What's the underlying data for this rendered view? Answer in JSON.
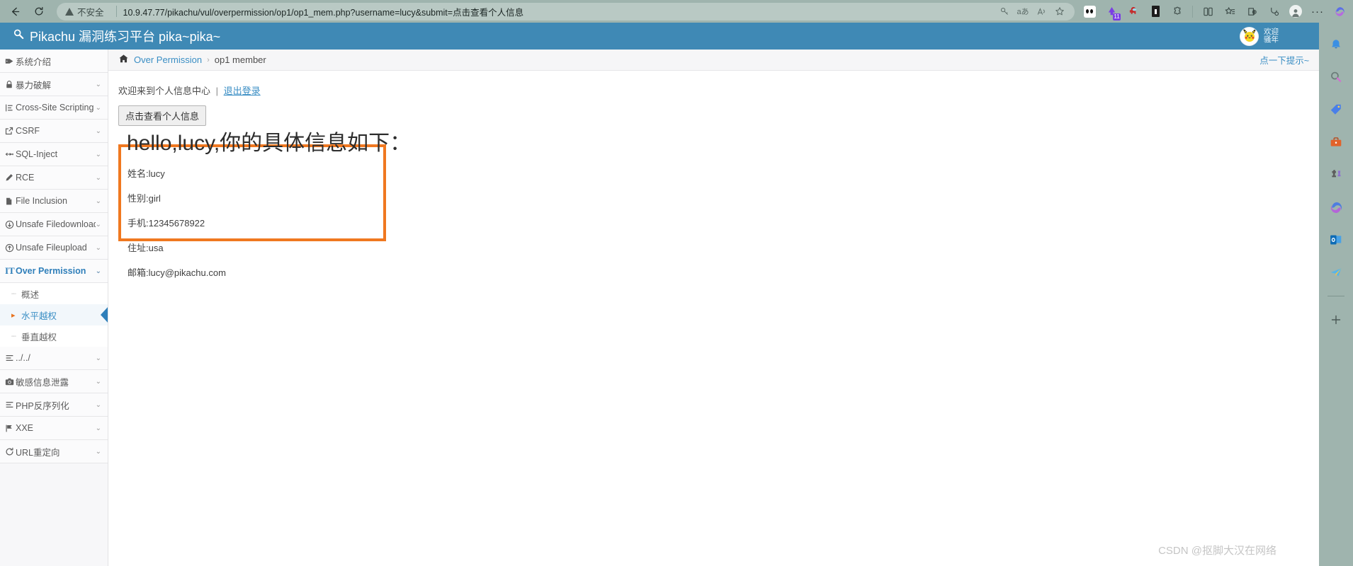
{
  "browser": {
    "back_icon": "back-arrow",
    "reload_icon": "reload",
    "security_label": "不安全",
    "url": "10.9.47.77/pikachu/vul/overpermission/op1/op1_mem.php?username=lucy&submit=点击查看个人信息",
    "omnibox_icons": [
      {
        "name": "key-icon",
        "glyph": "⚷"
      },
      {
        "name": "translate-icon",
        "glyph": "aあ"
      },
      {
        "name": "read-aloud-icon",
        "glyph": "A"
      }
    ],
    "favorite_icon": "☆",
    "toolbar_icons": [
      {
        "name": "extension-panda-icon",
        "glyph": "🐼"
      },
      {
        "name": "extension-purple-icon",
        "glyph": "🔮",
        "badge": "11"
      },
      {
        "name": "extension-amongus-icon",
        "glyph": "👾"
      },
      {
        "name": "extension-black-icon",
        "glyph": "▮"
      },
      {
        "name": "extension-puzzle-icon",
        "glyph": "🧩"
      },
      {
        "name": "split-screen-icon",
        "glyph": "◫"
      },
      {
        "name": "collections-icon",
        "glyph": "✩"
      },
      {
        "name": "browser-essentials-icon",
        "glyph": "⎙"
      },
      {
        "name": "performance-icon",
        "glyph": "🩺"
      },
      {
        "name": "profile-icon",
        "glyph": "👤"
      },
      {
        "name": "settings-more-icon",
        "glyph": "···"
      },
      {
        "name": "copilot-icon",
        "glyph": "◉"
      }
    ]
  },
  "edge_sidebar": {
    "icons": [
      {
        "name": "notifications-bell-icon",
        "glyph": "🔔"
      },
      {
        "name": "search-icon",
        "glyph": "🔍"
      },
      {
        "name": "shopping-tag-icon",
        "glyph": "🏷"
      },
      {
        "name": "tools-icon",
        "glyph": "🧰"
      },
      {
        "name": "games-icon",
        "glyph": "♟"
      },
      {
        "name": "copilot-icon",
        "glyph": "🌀"
      },
      {
        "name": "outlook-icon",
        "glyph": "📧"
      },
      {
        "name": "telegram-icon",
        "glyph": "📨"
      }
    ],
    "add_button": "+"
  },
  "site": {
    "title": "Pikachu 漏洞练习平台 pika~pika~",
    "title_icon": "magnifier-icon",
    "avatar_icon": "pikachu-avatar",
    "welcome_text": "欢迎骚年"
  },
  "nav": {
    "items": [
      {
        "label": "系统介绍",
        "icon": "tag-icon",
        "glyph": "🏷",
        "caret": false
      },
      {
        "label": "暴力破解",
        "icon": "lock-icon",
        "glyph": "🔒",
        "caret": true
      },
      {
        "label": "Cross-Site Scripting",
        "icon": "xss-icon",
        "glyph": "⊢",
        "caret": true
      },
      {
        "label": "CSRF",
        "icon": "external-link-icon",
        "glyph": "↗",
        "caret": true
      },
      {
        "label": "SQL-Inject",
        "icon": "syringe-icon",
        "glyph": "✚",
        "caret": true
      },
      {
        "label": "RCE",
        "icon": "pencil-icon",
        "glyph": "✎",
        "caret": true
      },
      {
        "label": "File Inclusion",
        "icon": "file-icon",
        "glyph": "🗋",
        "caret": true
      },
      {
        "label": "Unsafe Filedownload",
        "icon": "download-circle-icon",
        "glyph": "⊕",
        "caret": true
      },
      {
        "label": "Unsafe Fileupload",
        "icon": "upload-circle-icon",
        "glyph": "⊕",
        "caret": true
      },
      {
        "label": "Over Permission",
        "icon": "text-height-icon",
        "glyph": "IT",
        "caret": true,
        "active": true
      }
    ],
    "sub_items": [
      {
        "label": "概述",
        "selected": false
      },
      {
        "label": "水平越权",
        "selected": true
      },
      {
        "label": "垂直越权",
        "selected": false
      }
    ],
    "items_after": [
      {
        "label": "../../",
        "icon": "list-icon",
        "glyph": "☰",
        "caret": true
      },
      {
        "label": "敏感信息泄露",
        "icon": "camera-icon",
        "glyph": "📷",
        "caret": true
      },
      {
        "label": "PHP反序列化",
        "icon": "list-icon",
        "glyph": "☰",
        "caret": true
      },
      {
        "label": "XXE",
        "icon": "flag-icon",
        "glyph": "⚑",
        "caret": true
      },
      {
        "label": "URL重定向",
        "icon": "refresh-icon",
        "glyph": "↻",
        "caret": true
      }
    ]
  },
  "breadcrumb": {
    "home_icon": "home-icon",
    "parent": "Over Permission",
    "separator": "›",
    "current": "op1 member",
    "hint_link": "点一下提示~"
  },
  "content": {
    "welcome": "欢迎来到个人信息中心",
    "separator": "|",
    "logout_label": "退出登录",
    "view_info_button": "点击查看个人信息",
    "info_heading": "hello,lucy,你的具体信息如下：",
    "info_rows": [
      "姓名:lucy",
      "性别:girl",
      "手机:12345678922",
      "住址:usa",
      "邮箱:lucy@pikachu.com"
    ]
  },
  "watermark": "CSDN @抠脚大汉在网络",
  "colors": {
    "header_blue": "#3f89b5",
    "accent_orange": "#f07820",
    "link_blue": "#3a8ec4",
    "chrome_gray": "#9fb4ae"
  }
}
